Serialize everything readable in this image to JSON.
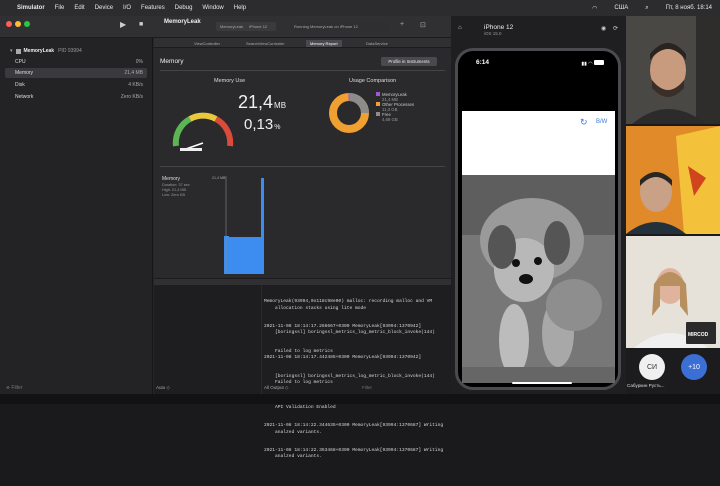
{
  "menubar": {
    "app": "Simulator",
    "items": [
      "File",
      "Edit",
      "Device",
      "I/O",
      "Features",
      "Debug",
      "Window",
      "Help"
    ],
    "locale": "США",
    "datetime": "Пт, 8 нояб. 18:14"
  },
  "xcode": {
    "scheme": "MemoryLeak",
    "device": "iPhone 12",
    "status": "Running MemoryLeak on iPhone 12",
    "process": "MemoryLeak",
    "pid": "PID 93994",
    "gauges": [
      {
        "label": "CPU",
        "value": "0%"
      },
      {
        "label": "Memory",
        "value": "21,4 MB"
      },
      {
        "label": "Disk",
        "value": "4 KB/s"
      },
      {
        "label": "Network",
        "value": "Zero KB/s"
      }
    ],
    "tabs": [
      "ViewController",
      "SearchViewController",
      "Memory Report",
      "DataService"
    ],
    "report": {
      "title": "Memory",
      "profile_button": "Profile in Instruments",
      "use_title": "Memory Use",
      "use_value": "21,4",
      "use_unit": "MB",
      "use_pct": "0,13",
      "use_pct_unit": "%",
      "comparison_title": "Usage Comparison",
      "legend": [
        {
          "name": "MemoryLeak",
          "value": "21,4 MB",
          "color": "#9b59d6"
        },
        {
          "name": "Other Processes",
          "value": "11,3 GB",
          "color": "#f0a030"
        },
        {
          "name": "Free",
          "value": "4,68 GB",
          "color": "#8c8c8c"
        }
      ],
      "graph_title": "Memory",
      "graph_info": [
        "Duration: 37 sec",
        "High: 21,4 MB",
        "Low: Zero KB"
      ],
      "graph_max": "21,4 MB"
    },
    "console_lines": [
      "MemoryLeak(93994,0x118c98e00) malloc: recording malloc and VM",
      "    allocation stacks using lite mode",
      "2021-11-08 18:14:17.266667+0300 MemoryLeak[93994:1370942]",
      "    [boringssl] boringssl_metrics_log_metric_block_invoke(144)",
      "    Failed to log metrics",
      "2021-11-08 18:14:17.442485+0300 MemoryLeak[93994:1370942]",
      "    [boringssl] boringssl_metrics_log_metric_block_invoke(144)",
      "    Failed to log metrics",
      "2021-11-08 18:14:17.840710+0300 MemoryLeak[93994:1370687] Metal",
      "    API Validation Enabled",
      "2021-11-08 18:14:22.344635+0300 MemoryLeak[93994:1370687] Writing",
      "    analzed variants.",
      "2021-11-08 18:14:22.353468+0300 MemoryLeak[93994:1370687] Writing",
      "    analzed variants."
    ],
    "bottom": {
      "auto": "Auto ◇",
      "filter": "Filter",
      "all_output": "All Output ◇"
    }
  },
  "simulator": {
    "title": "iPhone 12",
    "subtitle": "iOS 15.0",
    "time": "6:14",
    "bw_button": "B/W"
  },
  "meeting": {
    "self_initials": "СИ",
    "self_name": "Сабуркин Русть...",
    "more": "+10",
    "badge_text": "MIRCOD"
  }
}
